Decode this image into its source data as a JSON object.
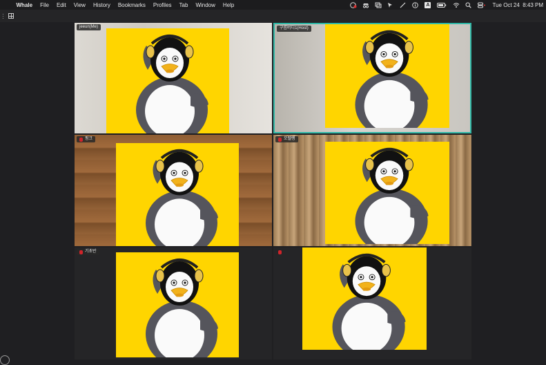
{
  "menubar": {
    "app_name": "Whale",
    "items": [
      "File",
      "Edit",
      "View",
      "History",
      "Bookmarks",
      "Profiles",
      "Tab",
      "Window",
      "Help"
    ],
    "input_source": "A",
    "datetime": "Tue Oct 24  8:43 PM"
  },
  "participants": [
    {
      "name": "jeeun(Me)",
      "background": "wall"
    },
    {
      "name": "구름버디1(Host)",
      "background": "room",
      "is_host": true
    },
    {
      "name": "핑크",
      "background": "wood"
    },
    {
      "name": "오렐렝",
      "background": "curtain"
    },
    {
      "name": "기초반",
      "background": "dark"
    },
    {
      "name": "",
      "background": "dark"
    }
  ],
  "colors": {
    "host_border": "#2fb8a6",
    "avatar_yellow": "#ffd500",
    "mic_muted": "#d0242a"
  },
  "icons": [
    "apple-logo-icon",
    "grid-layout-icon",
    "record-icon",
    "incognito-icon",
    "window-icon",
    "cursor-icon",
    "pen-icon",
    "info-icon",
    "battery-icon",
    "wifi-icon",
    "search-icon",
    "control-center-icon",
    "mic-muted-icon"
  ]
}
